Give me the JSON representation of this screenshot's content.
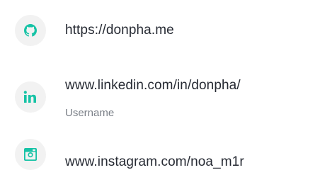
{
  "accent_color": "#17c3a6",
  "links": [
    {
      "icon": "github-icon",
      "text": "https://donpha.me"
    },
    {
      "icon": "linkedin-icon",
      "text": "www.linkedin.com/in/donpha/",
      "subtext": "Username"
    },
    {
      "icon": "instagram-icon",
      "text": "www.instagram.com/noa_m1r"
    }
  ]
}
